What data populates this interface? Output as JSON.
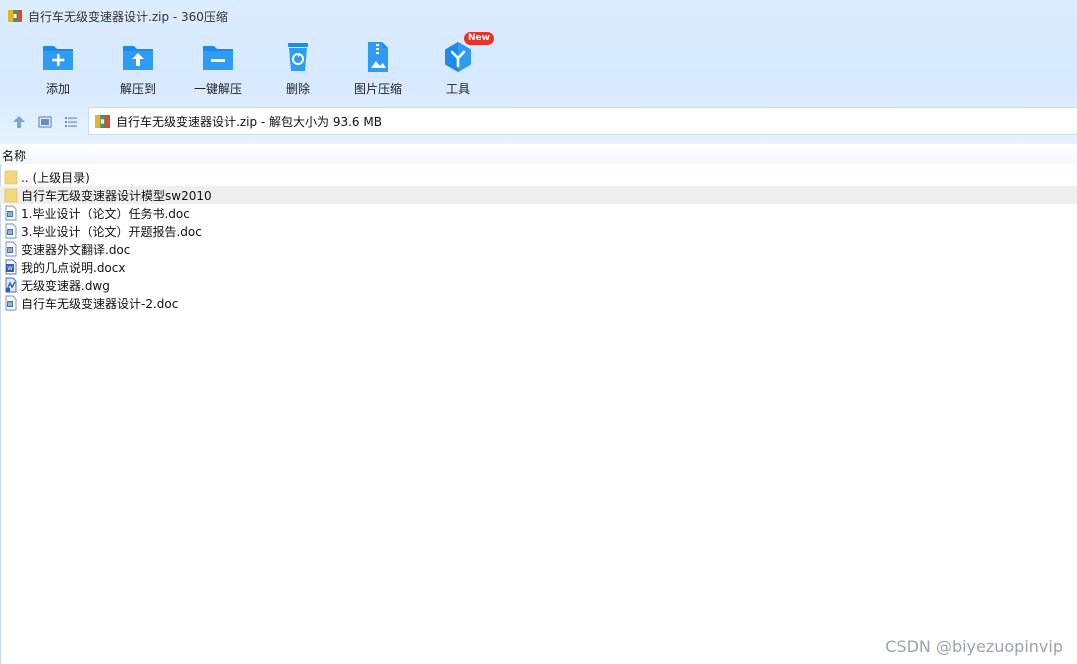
{
  "window": {
    "title": "自行车无级变速器设计.zip - 360压缩",
    "icon": "archive-icon"
  },
  "toolbar": {
    "items": [
      {
        "label": "添加",
        "icon": "add-folder-icon"
      },
      {
        "label": "解压到",
        "icon": "extract-to-icon"
      },
      {
        "label": "一键解压",
        "icon": "one-click-extract-icon"
      },
      {
        "label": "删除",
        "icon": "delete-bin-icon"
      },
      {
        "label": "图片压缩",
        "icon": "image-compress-icon"
      },
      {
        "label": "工具",
        "icon": "tools-icon",
        "badge": "New"
      }
    ]
  },
  "nav": {
    "up_icon": "up-arrow-icon",
    "thumbnail_icon": "thumbnail-view-icon",
    "list_icon": "list-view-icon"
  },
  "address": {
    "text": "自行车无级变速器设计.zip - 解包大小为 93.6 MB"
  },
  "columns": {
    "name": "名称"
  },
  "files": [
    {
      "name": ".. (上级目录)",
      "type": "folder"
    },
    {
      "name": "自行车无级变速器设计模型sw2010",
      "type": "folder",
      "highlighted": true
    },
    {
      "name": "1.毕业设计（论文）任务书.doc",
      "type": "doc"
    },
    {
      "name": "3.毕业设计（论文）开题报告.doc",
      "type": "doc"
    },
    {
      "name": "变速器外文翻译.doc",
      "type": "doc"
    },
    {
      "name": "我的几点说明.docx",
      "type": "docx"
    },
    {
      "name": "无级变速器.dwg",
      "type": "dwg"
    },
    {
      "name": "自行车无级变速器设计-2.doc",
      "type": "doc"
    }
  ],
  "watermark": "CSDN @biyezuopinvip",
  "colors": {
    "accent": "#1e8be8",
    "toolbar_bg": "#dcecff",
    "row_highlight": "#efefef",
    "badge": "#e8322b"
  }
}
